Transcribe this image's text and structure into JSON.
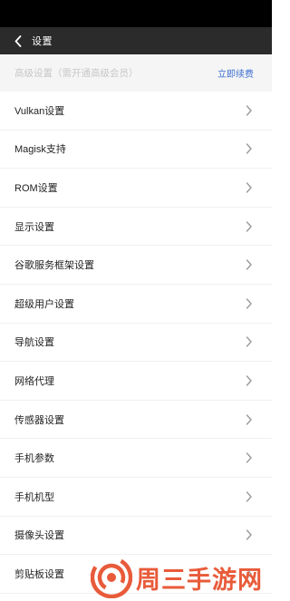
{
  "header": {
    "title": "设置",
    "back_icon": "chevron-left-icon"
  },
  "banner": {
    "notice": "高级设置（需开通高级会员）",
    "renew_label": "立即续费",
    "renew_color": "#3d6fd1"
  },
  "settings": {
    "items": [
      {
        "label": "Vulkan设置"
      },
      {
        "label": "Magisk支持"
      },
      {
        "label": "ROM设置"
      },
      {
        "label": "显示设置"
      },
      {
        "label": "谷歌服务框架设置"
      },
      {
        "label": "超级用户设置"
      },
      {
        "label": "导航设置"
      },
      {
        "label": "网络代理"
      },
      {
        "label": "传感器设置"
      },
      {
        "label": "手机参数"
      },
      {
        "label": "手机机型"
      },
      {
        "label": "摄像头设置"
      },
      {
        "label": "剪贴板设置"
      }
    ],
    "row_icon": "chevron-right-icon"
  },
  "watermark": {
    "text": "周三手游网",
    "color": "#e85b3a"
  }
}
